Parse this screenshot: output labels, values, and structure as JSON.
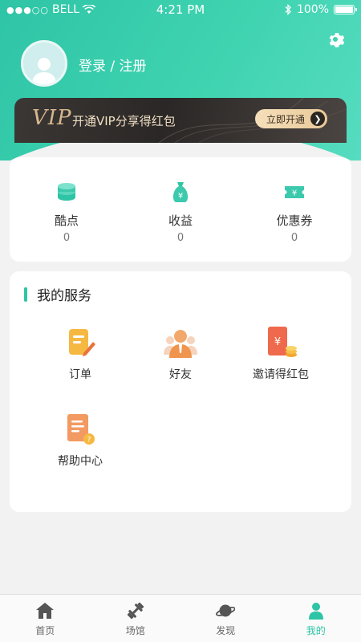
{
  "status_bar": {
    "carrier": "BELL",
    "time": "4:21 PM",
    "battery": "100%"
  },
  "profile": {
    "login_text": "登录 / 注册"
  },
  "vip": {
    "logo": "VIP",
    "text": "开通VIP分享得红包",
    "button_label": "立即开通"
  },
  "stats": [
    {
      "label": "酷点",
      "value": "0",
      "icon": "coins-stack-icon"
    },
    {
      "label": "收益",
      "value": "0",
      "icon": "money-bag-icon"
    },
    {
      "label": "优惠券",
      "value": "0",
      "icon": "coupon-icon"
    }
  ],
  "services": {
    "title": "我的服务",
    "items": [
      {
        "label": "订单",
        "icon": "order-icon"
      },
      {
        "label": "好友",
        "icon": "friends-icon"
      },
      {
        "label": "邀请得红包",
        "icon": "red-envelope-icon"
      },
      {
        "label": "帮助中心",
        "icon": "help-center-icon"
      }
    ]
  },
  "tabs": [
    {
      "label": "首页",
      "icon": "home-icon",
      "active": false
    },
    {
      "label": "场馆",
      "icon": "dumbbell-icon",
      "active": false
    },
    {
      "label": "发现",
      "icon": "planet-icon",
      "active": false
    },
    {
      "label": "我的",
      "icon": "profile-icon",
      "active": true
    }
  ],
  "colors": {
    "accent": "#2ec4a6",
    "vip_gold": "#d7b88e",
    "vip_dark": "#2a2726"
  }
}
